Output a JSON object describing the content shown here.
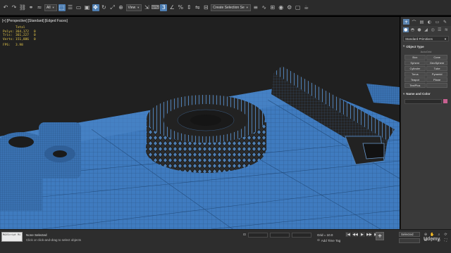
{
  "toolbar": {
    "selection_filter": "All",
    "reference_coord": "View",
    "named_selection": "Create Selection Se",
    "buttons": [
      {
        "name": "undo-icon",
        "glyph": "↶"
      },
      {
        "name": "redo-icon",
        "glyph": "↷"
      },
      {
        "name": "select-link-icon",
        "glyph": "⛓"
      },
      {
        "name": "unlink-icon",
        "glyph": "⚭"
      },
      {
        "name": "bind-spacewarp-icon",
        "glyph": "≈"
      },
      {
        "name": "select-object-icon",
        "glyph": "⬚"
      },
      {
        "name": "select-by-name-icon",
        "glyph": "☰"
      },
      {
        "name": "rect-selection-icon",
        "glyph": "▭"
      },
      {
        "name": "window-crossing-icon",
        "glyph": "▣"
      },
      {
        "name": "move-icon",
        "glyph": "✥"
      },
      {
        "name": "rotate-icon",
        "glyph": "↻"
      },
      {
        "name": "scale-icon",
        "glyph": "⤢"
      },
      {
        "name": "pivot-icon",
        "glyph": "⊕"
      },
      {
        "name": "select-manipulate-icon",
        "glyph": "⇲"
      },
      {
        "name": "keyboard-shortcut-icon",
        "glyph": "⌨"
      },
      {
        "name": "snaps-toggle-icon",
        "glyph": "3"
      },
      {
        "name": "angle-snap-icon",
        "glyph": "∠"
      },
      {
        "name": "percent-snap-icon",
        "glyph": "%"
      },
      {
        "name": "spinner-snap-icon",
        "glyph": "⇕"
      },
      {
        "name": "mirror-icon",
        "glyph": "⇋"
      },
      {
        "name": "align-icon",
        "glyph": "⊟"
      },
      {
        "name": "layer-explorer-icon",
        "glyph": "≡"
      },
      {
        "name": "curve-editor-icon",
        "glyph": "∿"
      },
      {
        "name": "schematic-view-icon",
        "glyph": "⊞"
      },
      {
        "name": "material-editor-icon",
        "glyph": "◉"
      },
      {
        "name": "render-setup-icon",
        "glyph": "⚙"
      },
      {
        "name": "rendered-frame-icon",
        "glyph": "▢"
      },
      {
        "name": "render-icon",
        "glyph": "☕"
      }
    ]
  },
  "viewport": {
    "label_parts": [
      "[+]",
      "[Perspective]",
      "[Standard]",
      "[Edged Faces]"
    ],
    "stats": {
      "header": "Total",
      "rows": [
        {
          "key": "Polys:",
          "total": "364,172",
          "sel": "0"
        },
        {
          "key": "Tris:",
          "total": "361,227",
          "sel": "0"
        },
        {
          "key": "Verts:",
          "total": "151,886",
          "sel": "0"
        }
      ],
      "fps_label": "FPS:",
      "fps_value": "3.98"
    }
  },
  "command_panel": {
    "tabs": [
      "+",
      "⌒",
      "▤",
      "◐",
      "▭",
      "✎"
    ],
    "category_icons": [
      "●",
      "◓",
      "●",
      "◢",
      "◎",
      "☰",
      "≋"
    ],
    "dropdown": "Standard Primitives",
    "object_type_title": "Object Type",
    "autogrid": "AutoGrid",
    "objects": [
      "Box",
      "Cone",
      "Sphere",
      "GeoSphere",
      "Cylinder",
      "Tube",
      "Torus",
      "Pyramid",
      "Teapot",
      "Plane",
      "TextPlus",
      ""
    ],
    "name_color_title": "Name and Color"
  },
  "status": {
    "maxscript": "MAXScript Mi",
    "line1": "None Selected",
    "line2": "Click or click-and-drag to select objects",
    "grid": "Grid = 10.0",
    "add_time_tag": "Add Time Tag",
    "selected": "Selected"
  },
  "playback": [
    "|◀",
    "◀◀",
    "▶",
    "▶▶",
    "▶|"
  ],
  "nav": [
    "⊕",
    "✋",
    "⌕",
    "⟳",
    "⊞",
    "⤢",
    "◎",
    "⛶"
  ],
  "watermark": "Udemy"
}
